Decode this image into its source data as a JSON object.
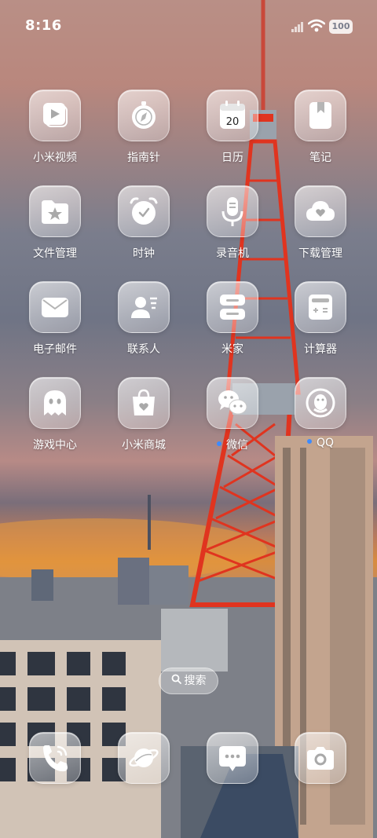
{
  "status_bar": {
    "time": "8:16",
    "battery": "100"
  },
  "apps": [
    {
      "label": "小米视频",
      "icon": "video-icon"
    },
    {
      "label": "指南针",
      "icon": "compass-icon"
    },
    {
      "label": "日历",
      "icon": "calendar-icon",
      "calendar_date": "20"
    },
    {
      "label": "笔记",
      "icon": "notes-icon"
    },
    {
      "label": "文件管理",
      "icon": "folder-star-icon"
    },
    {
      "label": "时钟",
      "icon": "clock-icon"
    },
    {
      "label": "录音机",
      "icon": "microphone-icon"
    },
    {
      "label": "下载管理",
      "icon": "cloud-heart-icon"
    },
    {
      "label": "电子邮件",
      "icon": "mail-icon"
    },
    {
      "label": "联系人",
      "icon": "contact-icon"
    },
    {
      "label": "米家",
      "icon": "mihome-icon"
    },
    {
      "label": "计算器",
      "icon": "calculator-icon"
    },
    {
      "label": "游戏中心",
      "icon": "ghost-icon"
    },
    {
      "label": "小米商城",
      "icon": "shopping-bag-icon"
    },
    {
      "label": "微信",
      "icon": "wechat-icon",
      "notification_dot": true
    },
    {
      "label": "QQ",
      "icon": "qq-penguin-icon",
      "notification_dot": true
    }
  ],
  "search": {
    "label": "搜索"
  },
  "dock": [
    {
      "icon": "phone-icon"
    },
    {
      "icon": "browser-planet-icon"
    },
    {
      "icon": "message-icon"
    },
    {
      "icon": "camera-icon"
    }
  ],
  "colors": {
    "notification_dot": "#3d8bff",
    "tower_red": "#e0341f"
  }
}
